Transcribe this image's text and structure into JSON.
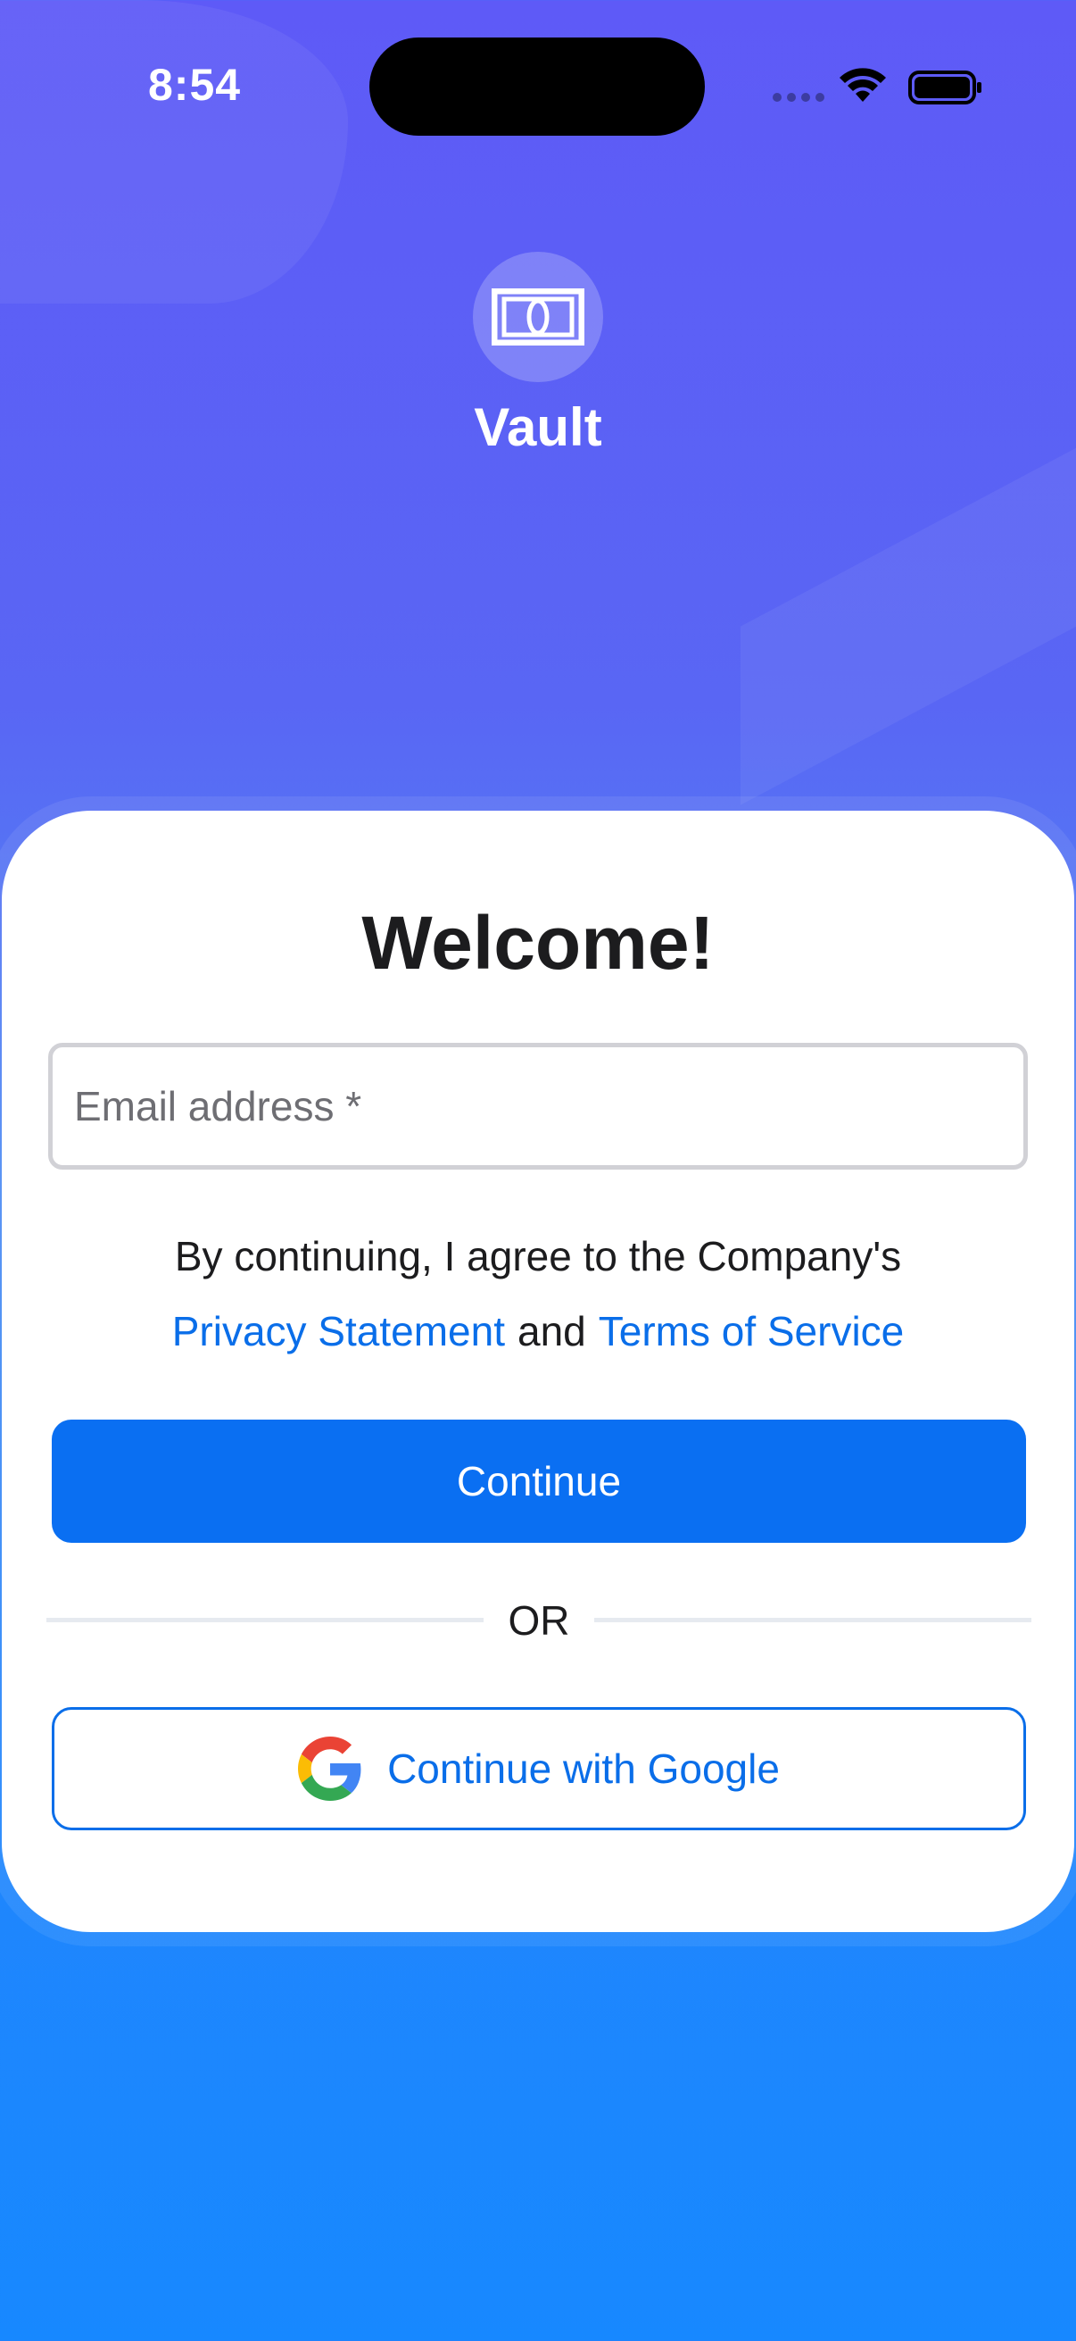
{
  "status_bar": {
    "time": "8:54"
  },
  "app": {
    "name": "Vault",
    "logo_icon": "banknote-icon"
  },
  "login": {
    "title": "Welcome!",
    "email_placeholder": "Email address *",
    "email_value": "",
    "agreement_text": "By continuing, I agree to the Company's",
    "privacy_link": "Privacy Statement",
    "and_word": "and",
    "terms_link": "Terms of Service",
    "continue_label": "Continue",
    "or_label": "OR",
    "google_label": "Continue with Google",
    "google_icon": "google-g-icon"
  },
  "colors": {
    "primary": "#0a6ff2",
    "link": "#0a6ee9",
    "background_top": "#5e5af7",
    "background_bottom": "#1788ff"
  }
}
